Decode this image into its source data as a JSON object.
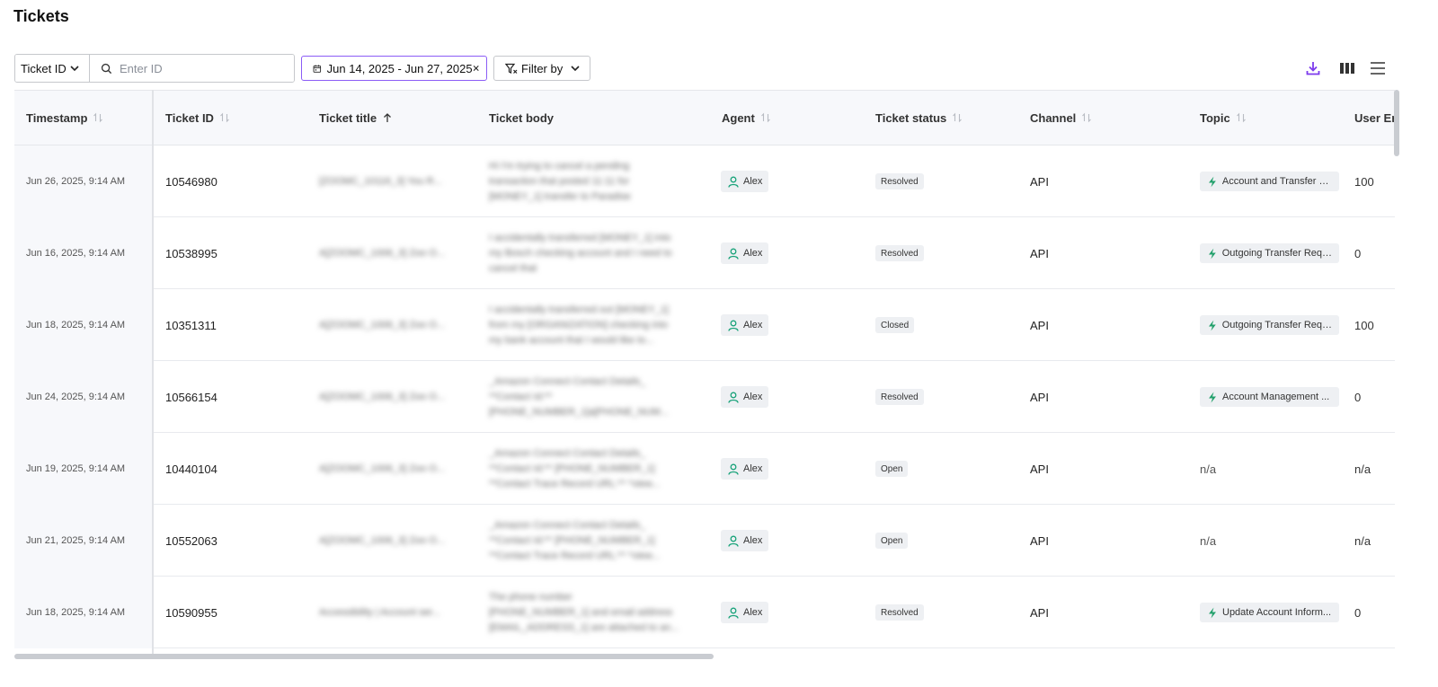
{
  "page": {
    "title": "Tickets"
  },
  "toolbar": {
    "id_type_label": "Ticket ID",
    "id_input_placeholder": "Enter ID",
    "date_range_label": "Jun 14, 2025 - Jun 27, 2025",
    "filter_label": "Filter by"
  },
  "table": {
    "headers": {
      "timestamp": "Timestamp",
      "ticket_id": "Ticket ID",
      "ticket_title": "Ticket title",
      "ticket_body": "Ticket body",
      "agent": "Agent",
      "ticket_status": "Ticket status",
      "channel": "Channel",
      "topic": "Topic",
      "user_en": "User En"
    },
    "rows": [
      {
        "timestamp": "Jun 26, 2025, 9:14 AM",
        "ticket_id": "10546980",
        "title": "[ZOOMC_10116_3] You R...",
        "body": [
          "Hi I'm trying to cancel a pending",
          "transaction that posted 11:11 for",
          "[MONEY_1] transfer to Paradise"
        ],
        "agent": "Alex",
        "status": "Resolved",
        "channel": "API",
        "topic": "Account and Transfer C...",
        "user_en": "100"
      },
      {
        "timestamp": "Jun 16, 2025, 9:14 AM",
        "ticket_id": "10538995",
        "title": "A[ZOOMC_1006_3] Zoo O...",
        "body": [
          "I accidentally transferred [MONEY_1] into",
          "my Bosch checking account and I need to",
          "cancel that"
        ],
        "agent": "Alex",
        "status": "Resolved",
        "channel": "API",
        "topic": "Outgoing Transfer Requ...",
        "user_en": "0"
      },
      {
        "timestamp": "Jun 18, 2025, 9:14 AM",
        "ticket_id": "10351311",
        "title": "A[ZOOMC_1006_3] Zoo O...",
        "body": [
          "I accidentally transferred out [MONEY_1]",
          "from my [ORGANIZATION] checking into",
          "my bank account that I would like to..."
        ],
        "agent": "Alex",
        "status": "Closed",
        "channel": "API",
        "topic": "Outgoing Transfer Requ...",
        "user_en": "100"
      },
      {
        "timestamp": "Jun 24, 2025, 9:14 AM",
        "ticket_id": "10566154",
        "title": "A[ZOOMC_1006_3] Zoo O...",
        "body": [
          "_Amazon Connect Contact Details_",
          "**Contact Id:**",
          "[PHONE_NUMBER_1]a[PHONE_NUM..."
        ],
        "agent": "Alex",
        "status": "Resolved",
        "channel": "API",
        "topic": "Account Management ...",
        "user_en": "0"
      },
      {
        "timestamp": "Jun 19, 2025, 9:14 AM",
        "ticket_id": "10440104",
        "title": "A[ZOOMC_1006_3] Zoo O...",
        "body": [
          "_Amazon Connect Contact Details_",
          "**Contact Id:** [PHONE_NUMBER_1]",
          "**Contact Trace Record URL:** *view..."
        ],
        "agent": "Alex",
        "status": "Open",
        "channel": "API",
        "topic": "n/a",
        "user_en": "n/a"
      },
      {
        "timestamp": "Jun 21, 2025, 9:14 AM",
        "ticket_id": "10552063",
        "title": "A[ZOOMC_1006_3] Zoo O...",
        "body": [
          "_Amazon Connect Contact Details_",
          "**Contact Id:** [PHONE_NUMBER_1]",
          "**Contact Trace Record URL:** *view..."
        ],
        "agent": "Alex",
        "status": "Open",
        "channel": "API",
        "topic": "n/a",
        "user_en": "n/a"
      },
      {
        "timestamp": "Jun 18, 2025, 9:14 AM",
        "ticket_id": "10590955",
        "title": "Accessibility | Account ser...",
        "body": [
          "The phone number",
          "[PHONE_NUMBER_1] and email address",
          "[EMAIL_ADDRESS_1] are attached to an..."
        ],
        "agent": "Alex",
        "status": "Resolved",
        "channel": "API",
        "topic": "Update Account Inform...",
        "user_en": "0"
      }
    ]
  },
  "icons": {
    "chevron": "chevron-down-icon",
    "search": "search-icon",
    "calendar": "calendar-icon",
    "clear": "close-icon",
    "filter": "filter-icon",
    "download": "download-icon",
    "columns": "columns-icon",
    "density": "menu-icon",
    "sort": "sort-icon",
    "sort_asc": "arrow-up-icon",
    "agent": "user-icon",
    "topic": "bolt-icon"
  },
  "colors": {
    "accent": "#8b5cf6",
    "agent_icon": "#1aa37a",
    "topic_icon": "#22a06b",
    "header_bg": "#f7f8fb"
  }
}
